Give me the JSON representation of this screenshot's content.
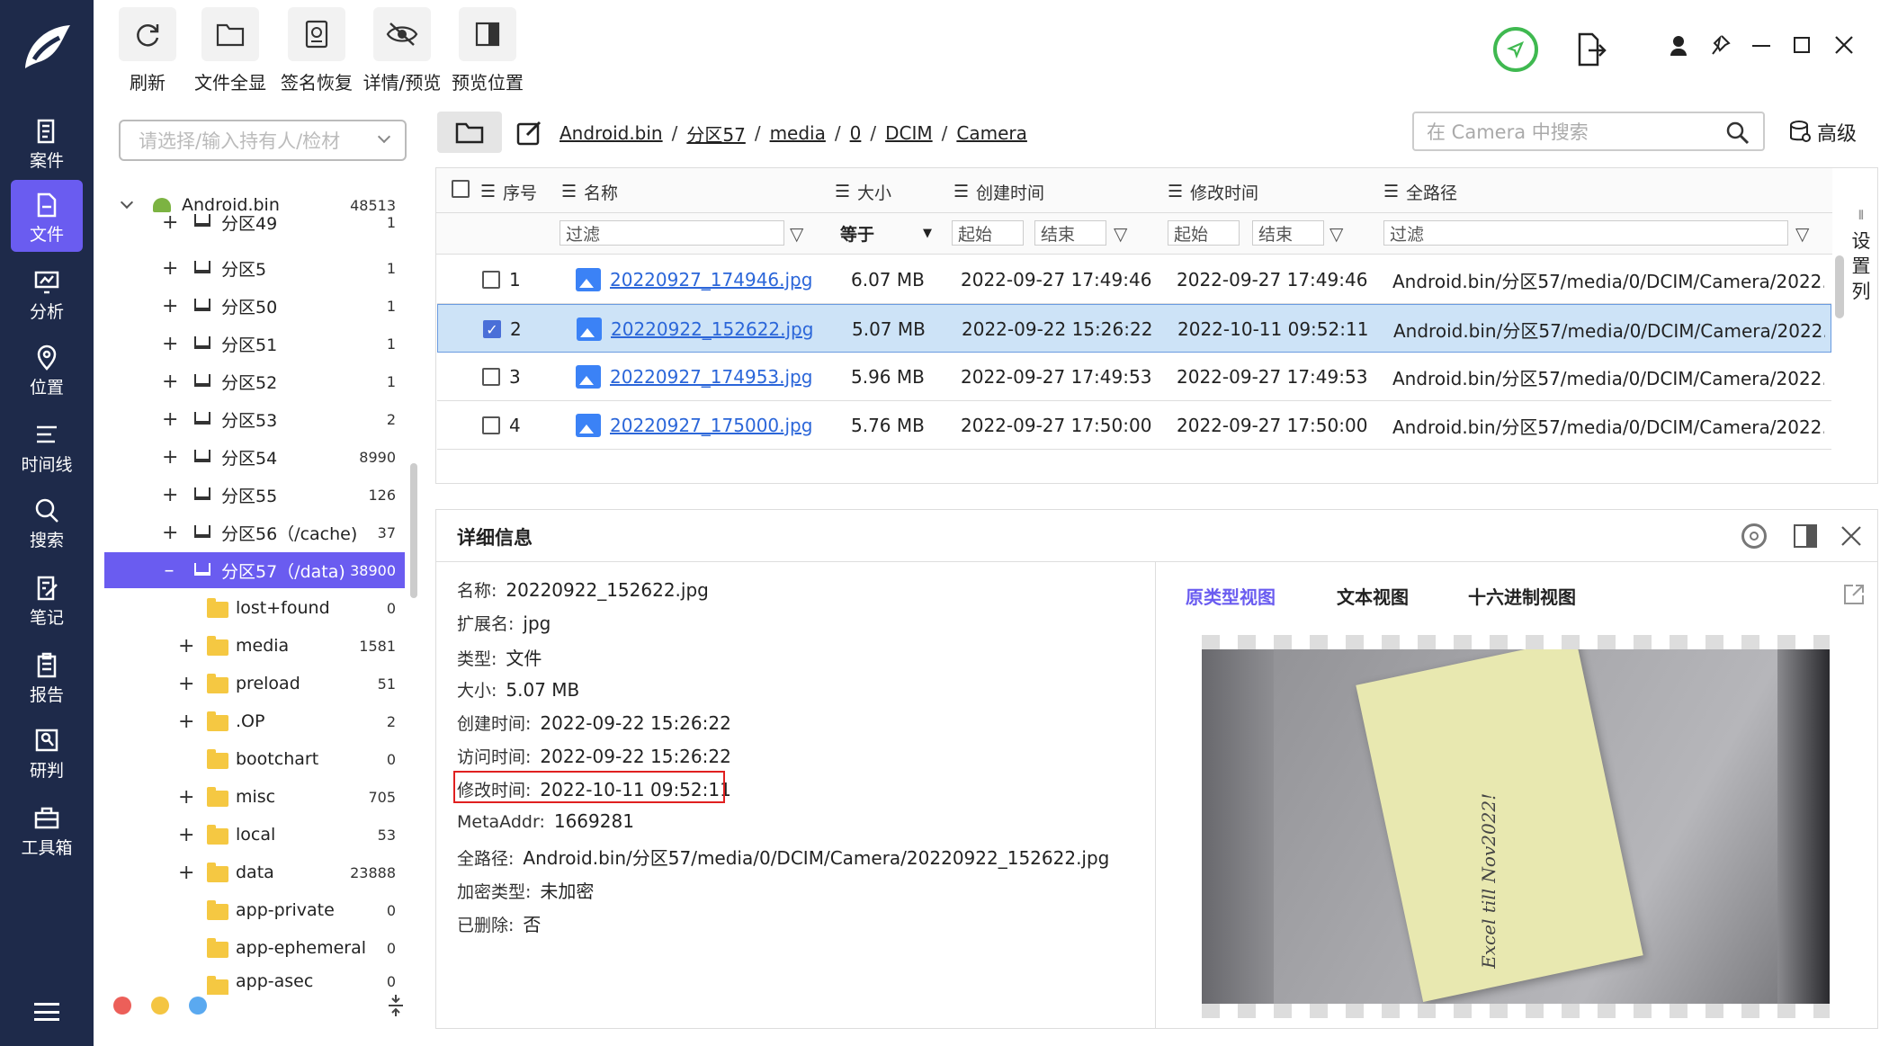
{
  "nav": {
    "items": [
      {
        "label": "案件",
        "icon": "case-icon"
      },
      {
        "label": "文件",
        "icon": "file-icon",
        "active": true
      },
      {
        "label": "分析",
        "icon": "analysis-icon"
      },
      {
        "label": "位置",
        "icon": "location-icon"
      },
      {
        "label": "时间线",
        "icon": "timeline-icon"
      },
      {
        "label": "搜索",
        "icon": "search-icon"
      },
      {
        "label": "笔记",
        "icon": "note-icon"
      },
      {
        "label": "报告",
        "icon": "report-icon"
      },
      {
        "label": "研判",
        "icon": "judge-icon"
      },
      {
        "label": "工具箱",
        "icon": "toolbox-icon"
      }
    ]
  },
  "toolbar": {
    "refresh": "刷新",
    "full_view": "文件全显",
    "sig_recover": "签名恢复",
    "detail_preview": "详情/预览",
    "preview_pos": "预览位置"
  },
  "owner_select": {
    "placeholder": "请选择/输入持有人/检材"
  },
  "tree": {
    "root": {
      "label": "Android.bin",
      "count": "48513"
    },
    "items": [
      {
        "label": "分区49",
        "count": "1"
      },
      {
        "label": "分区5",
        "count": "1"
      },
      {
        "label": "分区50",
        "count": "1"
      },
      {
        "label": "分区51",
        "count": "1"
      },
      {
        "label": "分区52",
        "count": "1"
      },
      {
        "label": "分区53",
        "count": "2"
      },
      {
        "label": "分区54",
        "count": "8990"
      },
      {
        "label": "分区55",
        "count": "126"
      },
      {
        "label": "分区56（/cache)",
        "count": "37"
      },
      {
        "label": "分区57（/data)",
        "count": "38900",
        "active": true
      }
    ],
    "folders": [
      {
        "label": "lost+found",
        "count": "0",
        "exp": false
      },
      {
        "label": "media",
        "count": "1581",
        "exp": true
      },
      {
        "label": "preload",
        "count": "51",
        "exp": true
      },
      {
        "label": ".OP",
        "count": "2",
        "exp": true
      },
      {
        "label": "bootchart",
        "count": "0",
        "exp": false
      },
      {
        "label": "misc",
        "count": "705",
        "exp": true
      },
      {
        "label": "local",
        "count": "53",
        "exp": true
      },
      {
        "label": "data",
        "count": "23888",
        "exp": true
      },
      {
        "label": "app-private",
        "count": "0",
        "exp": false
      },
      {
        "label": "app-ephemeral",
        "count": "0",
        "exp": false
      },
      {
        "label": "app-asec",
        "count": "0",
        "exp": false
      }
    ]
  },
  "breadcrumb": [
    "Android.bin",
    "分区57",
    "media",
    "0",
    "DCIM",
    "Camera"
  ],
  "search": {
    "placeholder": "在 Camera 中搜索",
    "advanced": "高级"
  },
  "table": {
    "headers": {
      "index": "序号",
      "name": "名称",
      "size": "大小",
      "created": "创建时间",
      "modified": "修改时间",
      "path": "全路径"
    },
    "filters": {
      "name": "过滤",
      "size": "等于",
      "c_start": "起始",
      "c_end": "结束",
      "m_start": "起始",
      "m_end": "结束",
      "path": "过滤"
    },
    "settings_col": "设置列",
    "rows": [
      {
        "idx": "1",
        "name": "20220927_174946.jpg",
        "size": "6.07 MB",
        "created": "2022-09-27 17:49:46",
        "modified": "2022-09-27 17:49:46",
        "path": "Android.bin/分区57/media/0/DCIM/Camera/2022..."
      },
      {
        "idx": "2",
        "name": "20220922_152622.jpg",
        "size": "5.07 MB",
        "created": "2022-09-22 15:26:22",
        "modified": "2022-10-11 09:52:11",
        "path": "Android.bin/分区57/media/0/DCIM/Camera/2022...",
        "selected": true
      },
      {
        "idx": "3",
        "name": "20220927_174953.jpg",
        "size": "5.96 MB",
        "created": "2022-09-27 17:49:53",
        "modified": "2022-09-27 17:49:53",
        "path": "Android.bin/分区57/media/0/DCIM/Camera/2022..."
      },
      {
        "idx": "4",
        "name": "20220927_175000.jpg",
        "size": "5.76 MB",
        "created": "2022-09-27 17:50:00",
        "modified": "2022-09-27 17:50:00",
        "path": "Android.bin/分区57/media/0/DCIM/Camera/2022..."
      }
    ]
  },
  "details": {
    "title": "详细信息",
    "fields": [
      {
        "k": "名称:",
        "v": "20220922_152622.jpg"
      },
      {
        "k": "扩展名:",
        "v": "jpg"
      },
      {
        "k": "类型:",
        "v": "文件"
      },
      {
        "k": "大小:",
        "v": "5.07 MB"
      },
      {
        "k": "创建时间:",
        "v": "2022-09-22 15:26:22"
      },
      {
        "k": "访问时间:",
        "v": "2022-09-22 15:26:22"
      },
      {
        "k": "修改时间:",
        "v": "2022-10-11 09:52:11",
        "highlight": true
      },
      {
        "k": "MetaAddr:",
        "v": "1669281"
      },
      {
        "k": "全路径:",
        "v": "Android.bin/分区57/media/0/DCIM/Camera/20220922_152622.jpg"
      },
      {
        "k": "加密类型:",
        "v": "未加密"
      },
      {
        "k": "已删除:",
        "v": "否"
      }
    ]
  },
  "preview": {
    "tabs": [
      "原类型视图",
      "文本视图",
      "十六进制视图"
    ],
    "note_text": "Excel till Nov2022!"
  },
  "colors": {
    "nav_bg": "#1e2a4a",
    "accent": "#6a5cf0",
    "link": "#2b66d9",
    "highlight_box": "#e02020"
  }
}
